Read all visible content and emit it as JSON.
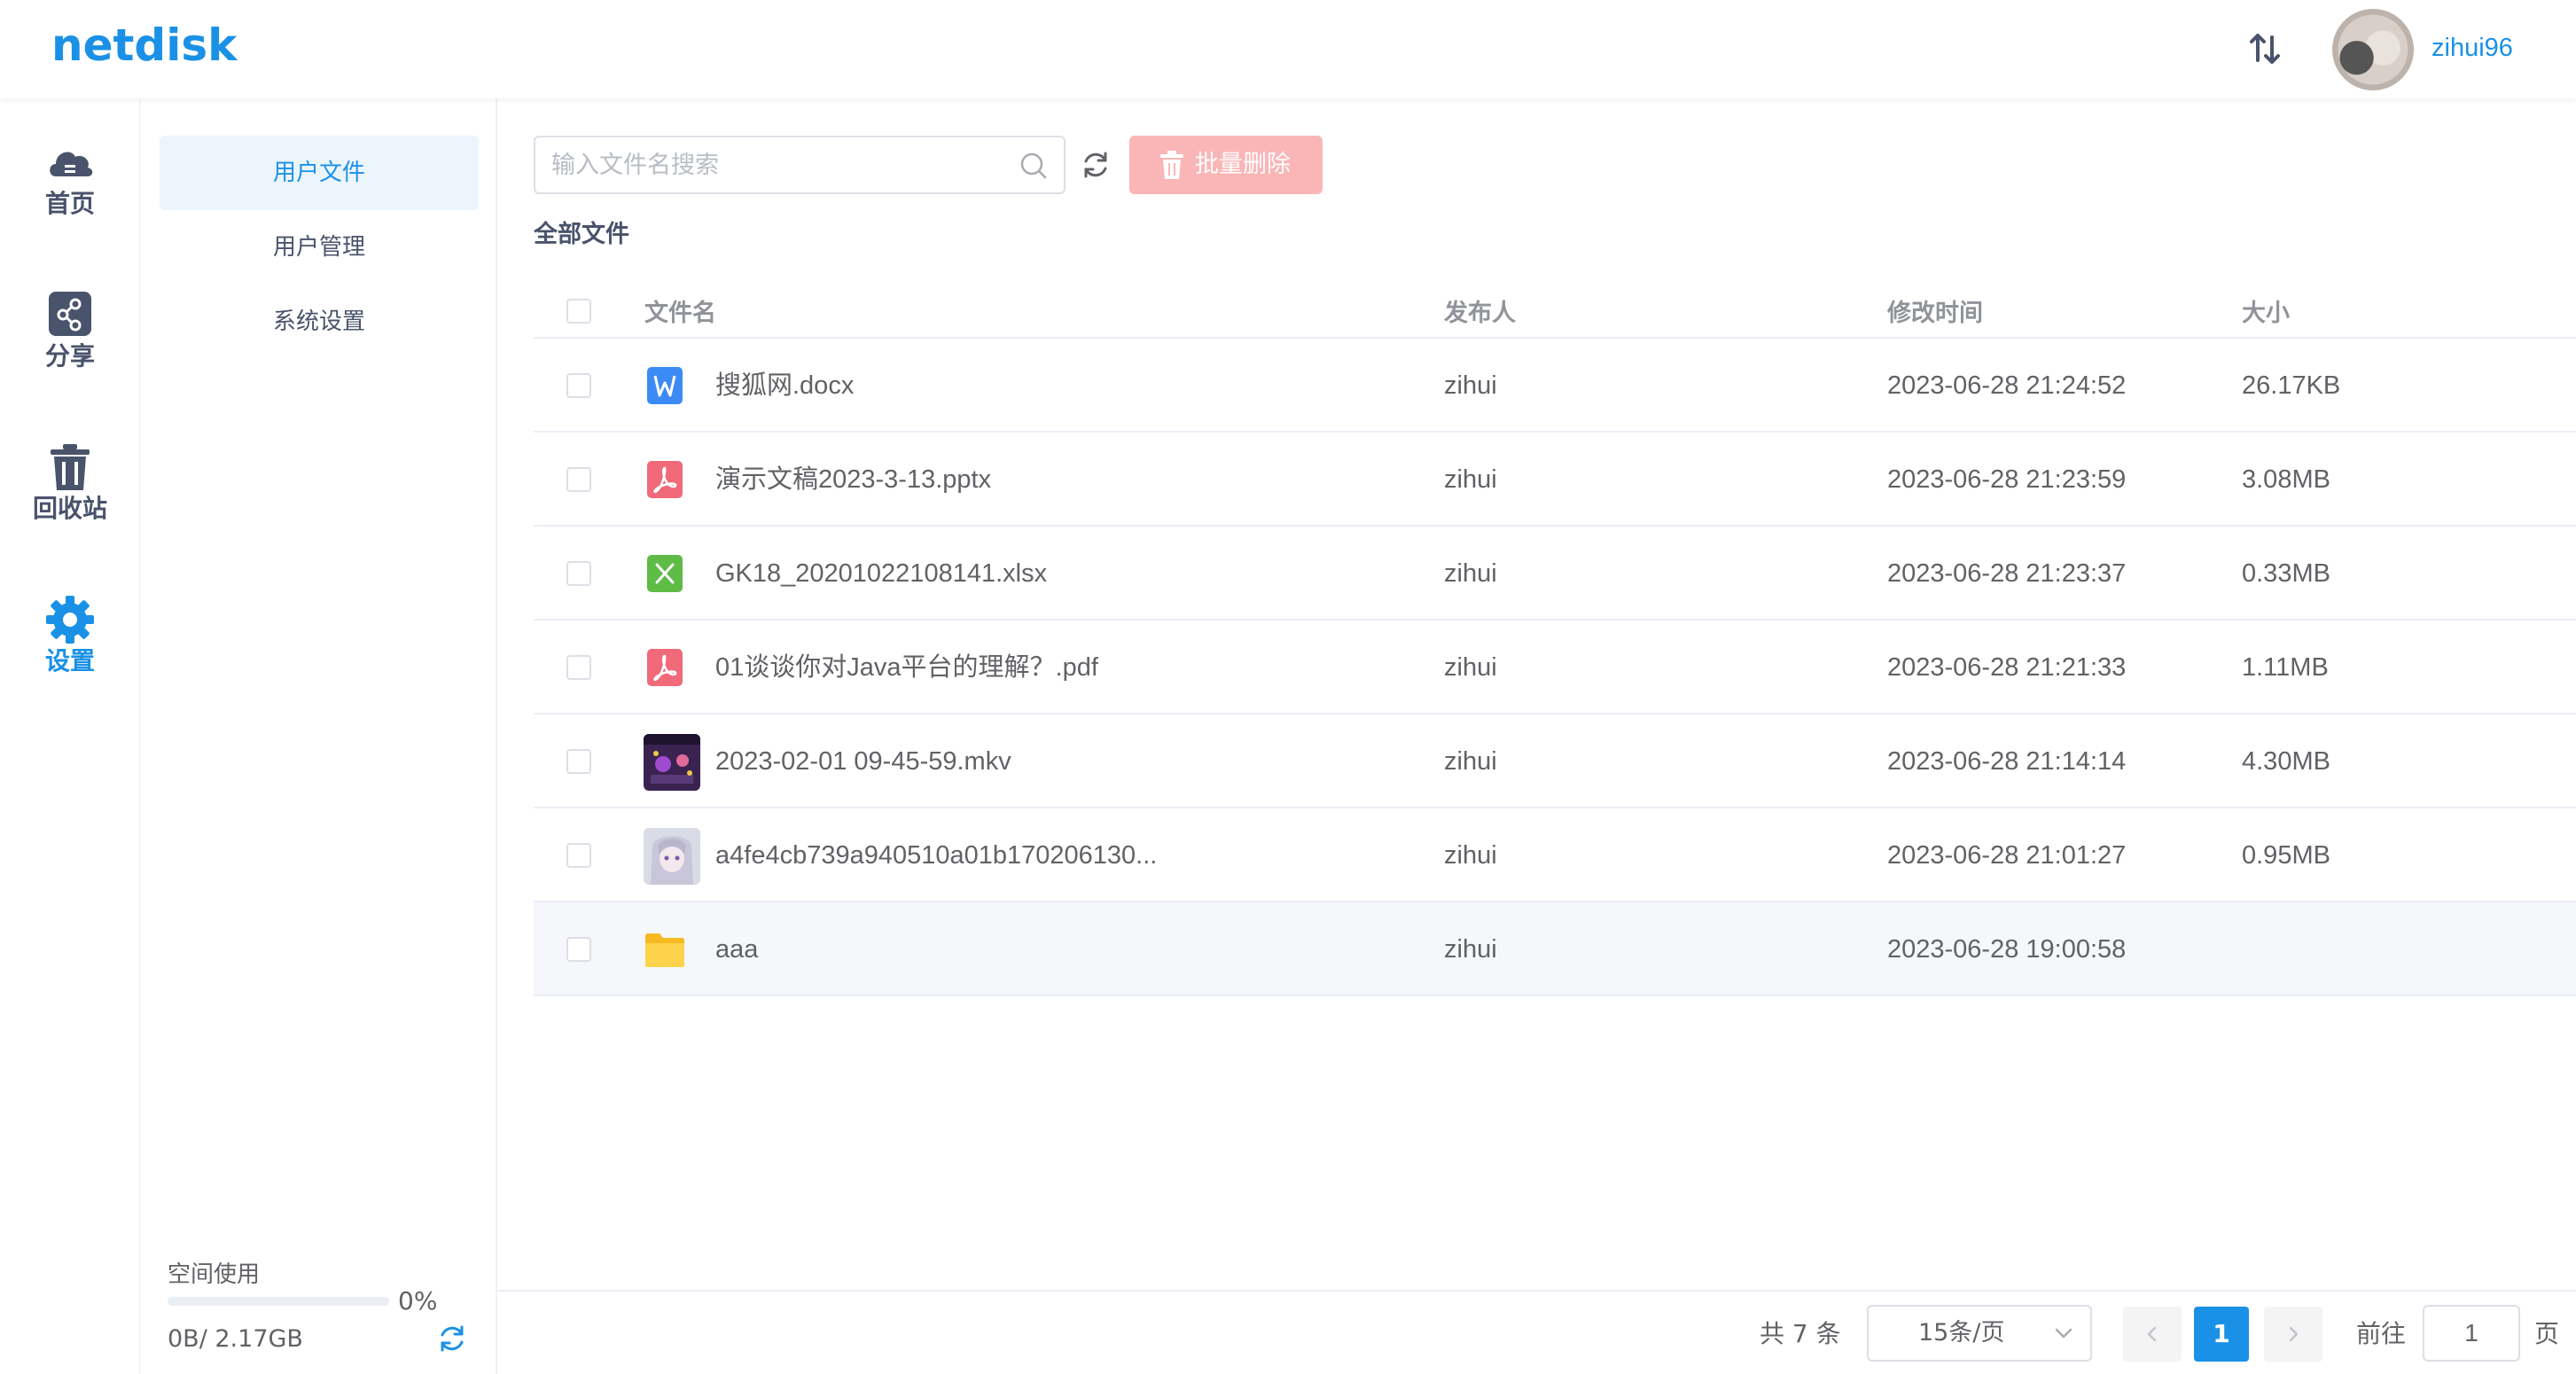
{
  "header": {
    "logo": "netdisk",
    "username": "zihui96",
    "icons": {
      "transfer": "sort-arrows-icon",
      "avatar": "user-avatar"
    }
  },
  "nav": {
    "items": [
      {
        "label": "首页",
        "icon": "cloud-home-icon"
      },
      {
        "label": "分享",
        "icon": "share-icon"
      },
      {
        "label": "回收站",
        "icon": "trash-icon"
      },
      {
        "label": "设置",
        "icon": "gear-icon",
        "active": true
      }
    ]
  },
  "submenu": {
    "items": [
      {
        "label": "用户文件",
        "active": true
      },
      {
        "label": "用户管理"
      },
      {
        "label": "系统设置"
      }
    ]
  },
  "storage": {
    "label": "空间使用",
    "percent_text": "0%",
    "used_fraction": 0,
    "size_text": "0B/ 2.17GB"
  },
  "toolbar": {
    "search_placeholder": "输入文件名搜索",
    "search_value": "",
    "batch_delete_label": "批量删除"
  },
  "breadcrumb": "全部文件",
  "table": {
    "columns": [
      "文件名",
      "发布人",
      "修改时间",
      "大小"
    ],
    "rows": [
      {
        "name": "搜狐网.docx",
        "icon": "word-file-icon",
        "owner": "zihui",
        "time": "2023-06-28 21:24:52",
        "size": "26.17KB"
      },
      {
        "name": "演示文稿2023-3-13.pptx",
        "icon": "pdf-file-icon",
        "owner": "zihui",
        "time": "2023-06-28 21:23:59",
        "size": "3.08MB"
      },
      {
        "name": "GK18_20201022108141.xlsx",
        "icon": "excel-file-icon",
        "owner": "zihui",
        "time": "2023-06-28 21:23:37",
        "size": "0.33MB"
      },
      {
        "name": "01谈谈你对Java平台的理解？.pdf",
        "icon": "pdf-file-icon",
        "owner": "zihui",
        "time": "2023-06-28 21:21:33",
        "size": "1.11MB"
      },
      {
        "name": "2023-02-01 09-45-59.mkv",
        "icon": "video-thumbnail",
        "owner": "zihui",
        "time": "2023-06-28 21:14:14",
        "size": "4.30MB"
      },
      {
        "name": "a4fe4cb739a940510a01b170206130...",
        "icon": "image-thumbnail",
        "owner": "zihui",
        "time": "2023-06-28 21:01:27",
        "size": "0.95MB"
      },
      {
        "name": "aaa",
        "icon": "folder-icon",
        "owner": "zihui",
        "time": "2023-06-28 19:00:58",
        "size": ""
      }
    ]
  },
  "pagination": {
    "total_text": "共 7 条",
    "page_size": "15条/页",
    "current_page": "1",
    "goto_label": "前往",
    "goto_value": "1",
    "page_suffix": "页"
  },
  "colors": {
    "accent": "#1a91e6",
    "danger_disabled": "#fab6b6",
    "text": "#606266",
    "header_text": "#909399"
  }
}
